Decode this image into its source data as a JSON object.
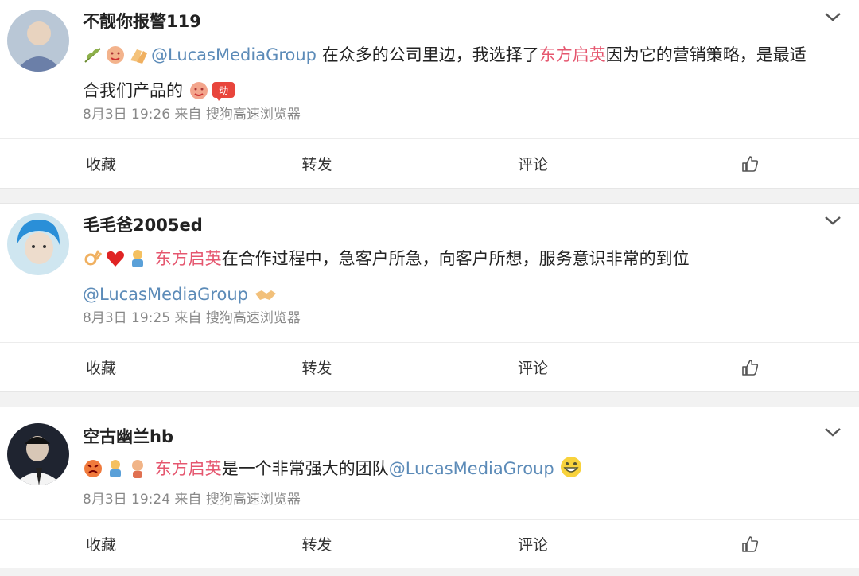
{
  "colors": {
    "mention": "#5c8bb8",
    "highlight": "#e5576f",
    "meta": "#888888"
  },
  "posts": [
    {
      "username": "不靓你报警119",
      "line1_pre_emoji": [
        "olive-branch-emoji",
        "face-emoji",
        "clap-emoji"
      ],
      "line1_mention": "@LucasMediaGroup",
      "line1_text_a": " 在众多的公司里边，我选择了",
      "line1_highlight": "东方启英",
      "line1_text_b": "因为它的营销策略，是最适",
      "line2_text": "合我们产品的",
      "line2_emoji": [
        "face-emoji",
        "move-badge-emoji"
      ],
      "meta": "8月3日 19:26 来自 搜狗高速浏览器"
    },
    {
      "username": "毛毛爸2005ed",
      "line1_pre_emoji": [
        "ok-hand-emoji",
        "heart-emoji",
        "figure-emoji"
      ],
      "line1_highlight": "东方启英",
      "line1_text": "在合作过程中，急客户所急，向客户所想，服务意识非常的到位",
      "line2_mention": "@LucasMediaGroup",
      "line2_emoji": [
        "handshake-emoji"
      ],
      "meta": "8月3日 19:25 来自 搜狗高速浏览器"
    },
    {
      "username": "空古幽兰hb",
      "line1_pre_emoji": [
        "angry-face-emoji",
        "figure-emoji",
        "figure-emoji"
      ],
      "line1_highlight": "东方启英",
      "line1_text": "是一个非常强大的团队",
      "line1_mention": "@LucasMediaGroup",
      "line1_emoji": [
        "grin-face-emoji"
      ],
      "meta": "8月3日 19:24 来自 搜狗高速浏览器"
    }
  ],
  "actions": {
    "favorite": "收藏",
    "repost": "转发",
    "comment": "评论",
    "like_icon": "thumbs-up-icon"
  }
}
